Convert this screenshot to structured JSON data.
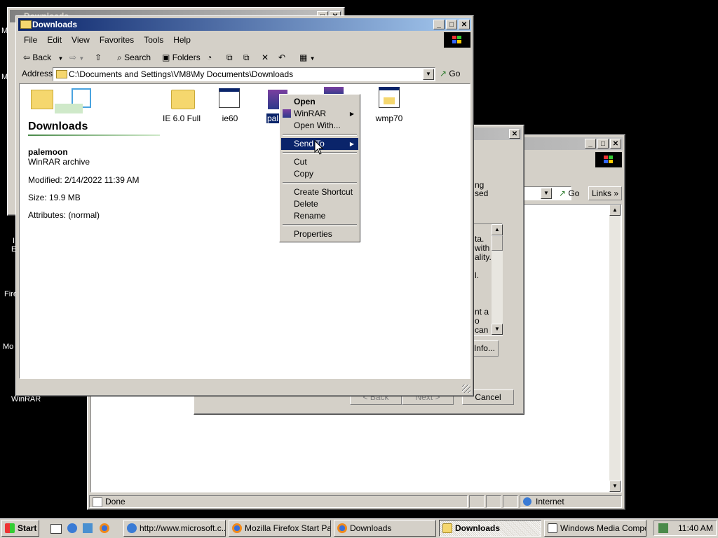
{
  "desktop": {
    "labels": [
      "M",
      "M",
      "I",
      "E",
      "Fire",
      "Mo",
      "WinRAR"
    ]
  },
  "bg_window": {
    "title": "Downloads"
  },
  "main_window": {
    "title": "Downloads",
    "menu": [
      "File",
      "Edit",
      "View",
      "Favorites",
      "Tools",
      "Help"
    ],
    "toolbar": {
      "back": "Back",
      "search": "Search",
      "folders": "Folders"
    },
    "address": {
      "label": "Address",
      "value": "C:\\Documents and Settings\\VM8\\My Documents\\Downloads",
      "go": "Go"
    },
    "info_panel": {
      "folder_title": "Downloads",
      "file_name": "palemoon",
      "file_type": "WinRAR archive",
      "modified": "Modified: 2/14/2022 11:39 AM",
      "size": "Size: 19.9 MB",
      "attributes": "Attributes: (normal)"
    },
    "files": [
      {
        "label": "IE 6.0 Full",
        "icon": "folder-icon"
      },
      {
        "label": "ie60",
        "icon": "window-icon"
      },
      {
        "label": "pal",
        "icon": "winrar-icon"
      },
      {
        "label": "",
        "icon": "winrar-icon"
      },
      {
        "label": "wmp70",
        "icon": "setup-icon"
      }
    ]
  },
  "context_menu": {
    "items": [
      "Open",
      "WinRAR",
      "Open With...",
      "Send To",
      "Cut",
      "Copy",
      "Create Shortcut",
      "Delete",
      "Rename",
      "Properties"
    ]
  },
  "dialog": {
    "fragments": [
      "ng",
      "sed",
      "ta.",
      "with",
      "ality.",
      "l.",
      "nt a",
      "o",
      "can"
    ],
    "info_button": "Info...",
    "back_button": "< Back",
    "next_button": "Next >",
    "cancel_button": "Cancel"
  },
  "browser_window": {
    "go": "Go",
    "links": "Links",
    "status": "Done",
    "zone": "Internet"
  },
  "taskbar": {
    "start": "Start",
    "tasks": [
      "http://www.microsoft.c...",
      "Mozilla Firefox Start Pag...",
      "Downloads",
      "Downloads",
      "Windows Media Compo..."
    ],
    "clock": "11:40 AM"
  },
  "colors": {
    "title_active": "#0a246a",
    "menu_highlight": "#0a246a",
    "window_face": "#d4d0c8"
  }
}
